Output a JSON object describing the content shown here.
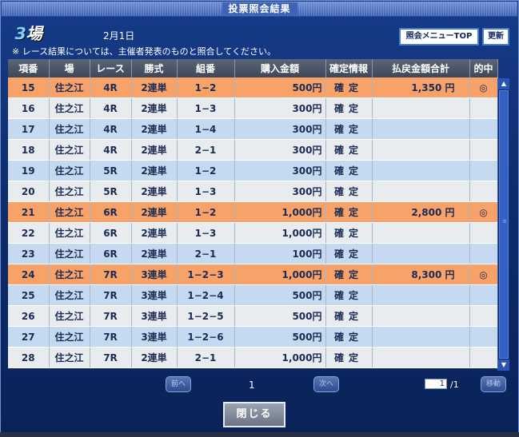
{
  "window": {
    "title": "投票照会結果"
  },
  "header": {
    "venue_num": "3",
    "venue_suffix": "場",
    "date": "2月1日",
    "notice": "※ レース結果については、主催者発表のものと照合してください。",
    "menu_top_label": "照会メニューTOP",
    "refresh_label": "更新"
  },
  "table": {
    "columns": [
      "項番",
      "場",
      "レース",
      "勝式",
      "組番",
      "購入金額",
      "確定情報",
      "払戻金額合計",
      "的中"
    ],
    "rows": [
      {
        "no": "15",
        "venue": "住之江",
        "race": "4R",
        "type": "2連単",
        "combo": "1−2",
        "amount": "500円",
        "status": "確定",
        "payout": "1,350 円",
        "hit": "◎"
      },
      {
        "no": "16",
        "venue": "住之江",
        "race": "4R",
        "type": "2連単",
        "combo": "1−3",
        "amount": "300円",
        "status": "確定",
        "payout": "",
        "hit": ""
      },
      {
        "no": "17",
        "venue": "住之江",
        "race": "4R",
        "type": "2連単",
        "combo": "1−4",
        "amount": "300円",
        "status": "確定",
        "payout": "",
        "hit": ""
      },
      {
        "no": "18",
        "venue": "住之江",
        "race": "4R",
        "type": "2連単",
        "combo": "2−1",
        "amount": "300円",
        "status": "確定",
        "payout": "",
        "hit": ""
      },
      {
        "no": "19",
        "venue": "住之江",
        "race": "5R",
        "type": "2連単",
        "combo": "1−2",
        "amount": "300円",
        "status": "確定",
        "payout": "",
        "hit": ""
      },
      {
        "no": "20",
        "venue": "住之江",
        "race": "5R",
        "type": "2連単",
        "combo": "1−3",
        "amount": "300円",
        "status": "確定",
        "payout": "",
        "hit": ""
      },
      {
        "no": "21",
        "venue": "住之江",
        "race": "6R",
        "type": "2連単",
        "combo": "1−2",
        "amount": "1,000円",
        "status": "確定",
        "payout": "2,800 円",
        "hit": "◎"
      },
      {
        "no": "22",
        "venue": "住之江",
        "race": "6R",
        "type": "2連単",
        "combo": "1−3",
        "amount": "1,000円",
        "status": "確定",
        "payout": "",
        "hit": ""
      },
      {
        "no": "23",
        "venue": "住之江",
        "race": "6R",
        "type": "2連単",
        "combo": "2−1",
        "amount": "100円",
        "status": "確定",
        "payout": "",
        "hit": ""
      },
      {
        "no": "24",
        "venue": "住之江",
        "race": "7R",
        "type": "3連単",
        "combo": "1−2−3",
        "amount": "1,000円",
        "status": "確定",
        "payout": "8,300 円",
        "hit": "◎"
      },
      {
        "no": "25",
        "venue": "住之江",
        "race": "7R",
        "type": "3連単",
        "combo": "1−2−4",
        "amount": "500円",
        "status": "確定",
        "payout": "",
        "hit": ""
      },
      {
        "no": "26",
        "venue": "住之江",
        "race": "7R",
        "type": "3連単",
        "combo": "1−2−5",
        "amount": "500円",
        "status": "確定",
        "payout": "",
        "hit": ""
      },
      {
        "no": "27",
        "venue": "住之江",
        "race": "7R",
        "type": "3連単",
        "combo": "1−2−6",
        "amount": "500円",
        "status": "確定",
        "payout": "",
        "hit": ""
      },
      {
        "no": "28",
        "venue": "住之江",
        "race": "7R",
        "type": "2連単",
        "combo": "2−1",
        "amount": "1,000円",
        "status": "確定",
        "payout": "",
        "hit": ""
      }
    ]
  },
  "pager": {
    "prev_label": "前へ",
    "next_label": "次へ",
    "current_page": "1",
    "page_input": "1",
    "page_total": "/1",
    "go_label": "移動"
  },
  "footer": {
    "close_label": "閉じる"
  },
  "colors": {
    "hit_row": "#f7a268",
    "blue_row": "#c5d9f0",
    "grey_row": "#e9ecef",
    "frame": "#0d2c6e"
  },
  "icons": {
    "scroll_up": "triangle-up-icon",
    "scroll_down": "triangle-down-icon",
    "hit_mark": "double-circle-icon"
  }
}
